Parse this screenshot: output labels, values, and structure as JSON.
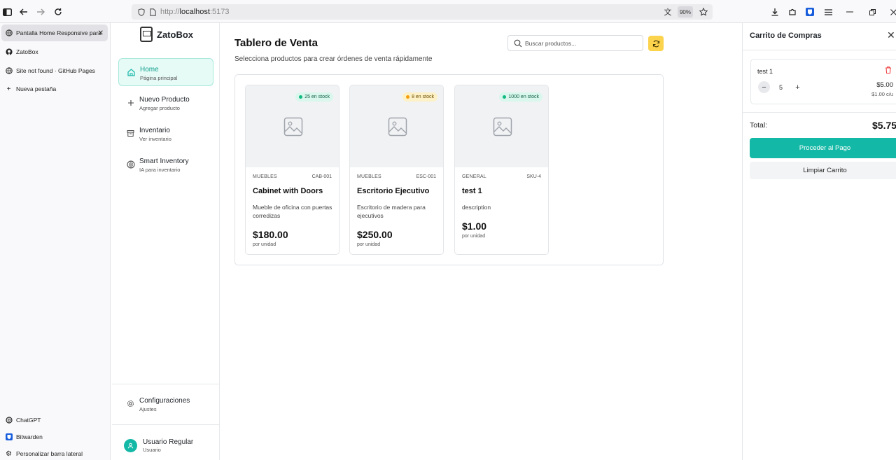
{
  "browser": {
    "url_prefix": "http://",
    "url_host": "localhost",
    "url_port": ":5173",
    "zoom": "90%",
    "tabs": [
      {
        "label": "Pantalla Home Responsive para",
        "icon": "globe-icon"
      },
      {
        "label": "ZatoBox",
        "icon": "github-icon"
      },
      {
        "label": "Site not found · GitHub Pages",
        "icon": "globe-icon"
      },
      {
        "label": "Nueva pestaña",
        "icon": "plus-icon"
      }
    ],
    "bottom_items": [
      {
        "label": "ChatGPT",
        "icon": "chatgpt-icon"
      },
      {
        "label": "Bitwarden",
        "icon": "bitwarden-icon"
      },
      {
        "label": "Personalizar barra lateral",
        "icon": "gear-icon"
      }
    ]
  },
  "app": {
    "logo_text": "ZatoBox",
    "nav": [
      {
        "label": "Home",
        "sub": "Página principal",
        "icon": "home-icon"
      },
      {
        "label": "Nuevo Producto",
        "sub": "Agregar producto",
        "icon": "plus-icon"
      },
      {
        "label": "Inventario",
        "sub": "Ver inventario",
        "icon": "archive-icon"
      },
      {
        "label": "Smart Inventory",
        "sub": "IA para inventario",
        "icon": "brain-icon"
      }
    ],
    "settings": {
      "label": "Configuraciones",
      "sub": "Ajustes"
    },
    "user": {
      "name": "Usuario Regular",
      "role": "Usuario"
    }
  },
  "main": {
    "title": "Tablero de Venta",
    "subtitle": "Selecciona productos para crear órdenes de venta rápidamente",
    "search_placeholder": "Buscar productos...",
    "products": [
      {
        "stock": "25 en stock",
        "stock_color": "#10b981",
        "category": "MUEBLES",
        "sku": "CAB-001",
        "name": "Cabinet with Doors",
        "description": "Mueble de oficina con puertas corredizas",
        "price": "$180.00",
        "unit": "por unidad"
      },
      {
        "stock": "8 en stock",
        "stock_color": "#f59e0b",
        "category": "MUEBLES",
        "sku": "ESC-001",
        "name": "Escritorio Ejecutivo",
        "description": "Escritorio de madera para ejecutivos",
        "price": "$250.00",
        "unit": "por unidad"
      },
      {
        "stock": "1000 en stock",
        "stock_color": "#10b981",
        "category": "GENERAL",
        "sku": "SKU-4",
        "name": "test 1",
        "description": "description",
        "price": "$1.00",
        "unit": "por unidad"
      }
    ]
  },
  "cart": {
    "title": "Carrito de Compras",
    "item": {
      "name": "test 1",
      "qty": "5",
      "price": "$5.00",
      "unit_price": "$1.00 c/u"
    },
    "total_label": "Total:",
    "total_value": "$5.75",
    "pay_label": "Proceder al Pago",
    "clear_label": "Limpiar Carrito"
  },
  "colors": {
    "accent": "#14b8a6",
    "refresh": "#fcd34d",
    "delete": "#ef4444"
  }
}
